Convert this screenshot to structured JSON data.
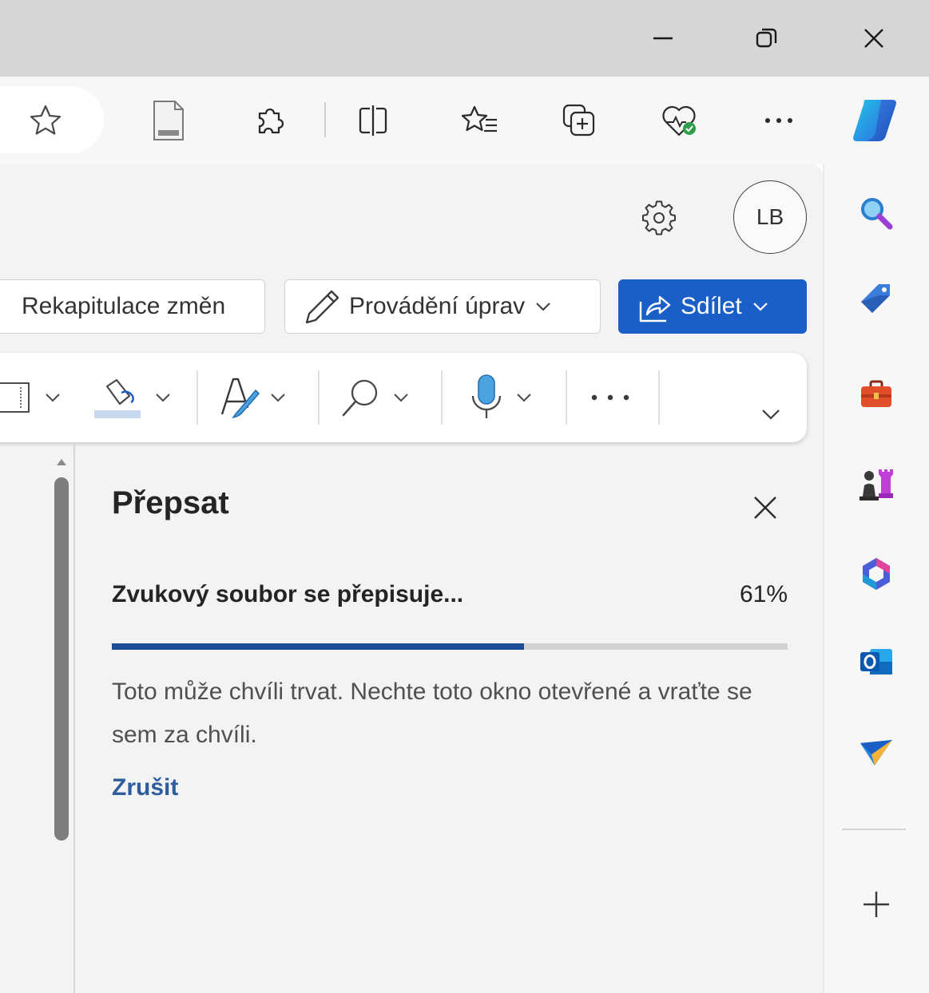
{
  "window": {
    "minimize_icon": "minimize-icon",
    "restore_icon": "restore-icon",
    "close_icon": "close-icon"
  },
  "toolbar": {
    "icons": [
      "favorite-star-icon",
      "document-icon",
      "extensions-icon",
      "split-screen-icon",
      "favorites-icon",
      "collections-icon",
      "browser-essentials-icon",
      "more-icon",
      "copilot-icon"
    ]
  },
  "header": {
    "avatar_initials": "LB",
    "settings_icon": "gear-icon"
  },
  "actions": {
    "review_label": "Rekapitulace změn",
    "edit_label": "Provádění úprav",
    "share_label": "Sdílet",
    "accent_color": "#1a5fc7"
  },
  "ribbon": {
    "icons": [
      "borders-icon",
      "shading-icon",
      "styles-icon",
      "find-icon",
      "dictate-icon",
      "more-icon",
      "expand-icon"
    ]
  },
  "pane": {
    "title": "Přepsat",
    "status": "Zvukový soubor se přepisuje...",
    "percent_label": "61%",
    "progress": 0.61,
    "info": "Toto může chvíli trvat. Nechte toto okno otevřené a vraťte se sem za chvíli.",
    "cancel_label": "Zrušit",
    "progress_color": "#1c4c96"
  },
  "sidebar": {
    "icons": [
      "search-icon",
      "shopping-tag-icon",
      "tools-icon",
      "games-icon",
      "microsoft-365-icon",
      "outlook-icon",
      "drop-icon",
      "add-icon"
    ]
  }
}
